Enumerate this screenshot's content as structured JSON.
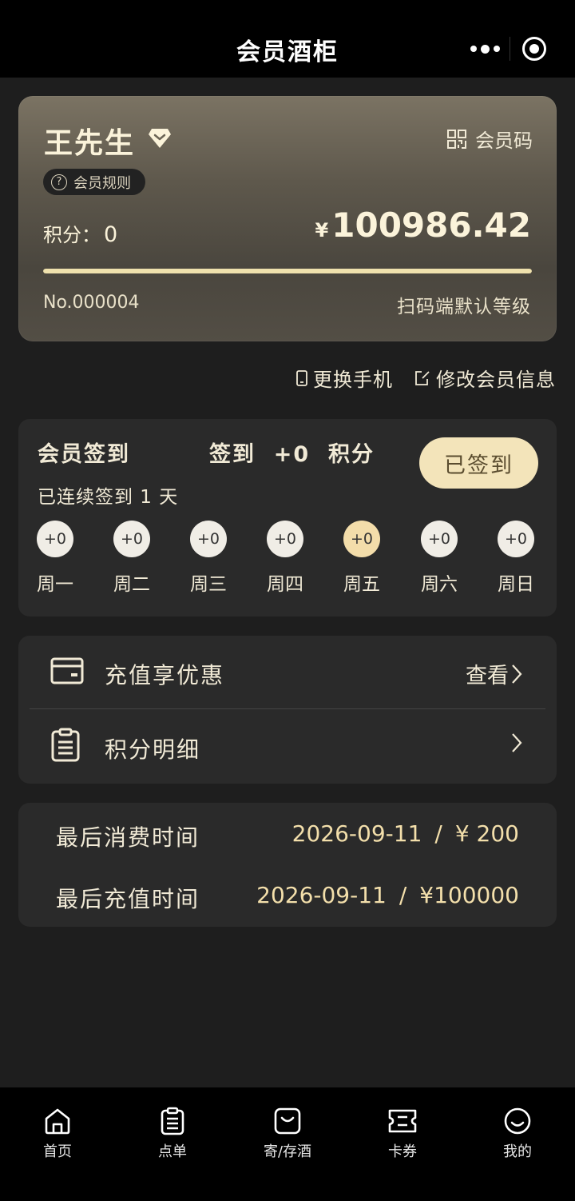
{
  "header": {
    "title": "会员酒柜"
  },
  "card": {
    "name": "王先生",
    "member_code_label": "会员码",
    "rules_label": "会员规则",
    "points_label": "积分：",
    "points_value": "0",
    "currency": "¥",
    "balance": "100986.42",
    "progress_fraction": 1.0,
    "member_no": "No.000004",
    "level": "扫码端默认等级"
  },
  "links": {
    "change_phone": "更换手机",
    "edit_info": "修改会员信息"
  },
  "signin": {
    "title": "会员签到",
    "reward_text": "签到  +0  积分",
    "streak_text": "已连续签到 1 天",
    "button_label": "已签到",
    "days": [
      {
        "points": "+0",
        "label": "周一"
      },
      {
        "points": "+0",
        "label": "周二"
      },
      {
        "points": "+0",
        "label": "周三"
      },
      {
        "points": "+0",
        "label": "周四"
      },
      {
        "points": "+0",
        "label": "周五"
      },
      {
        "points": "+0",
        "label": "周六"
      },
      {
        "points": "+0",
        "label": "周日"
      }
    ]
  },
  "menu": {
    "recharge_label": "充值享优惠",
    "recharge_action": "查看",
    "points_detail_label": "积分明细"
  },
  "last": {
    "consume_label": "最后消费时间",
    "consume_date": "2026-09-11",
    "consume_amount": "¥ 200",
    "recharge_label": "最后充值时间",
    "recharge_date": "2026-09-11",
    "recharge_amount": "¥100000"
  },
  "tabs": [
    {
      "label": "首页",
      "icon": "home-icon"
    },
    {
      "label": "点单",
      "icon": "order-icon"
    },
    {
      "label": "寄/存酒",
      "icon": "storage-icon"
    },
    {
      "label": "卡券",
      "icon": "coupon-icon"
    },
    {
      "label": "我的",
      "icon": "profile-icon"
    }
  ],
  "colors": {
    "accent": "#f3e4ba",
    "card_top": "#7b7363",
    "background": "#1e1e1e"
  }
}
